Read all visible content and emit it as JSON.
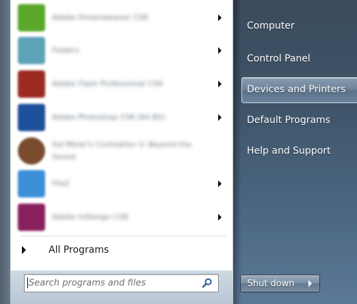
{
  "left_pane": {
    "programs": [
      {
        "label": "Adobe Dreamweaver CS6",
        "icon": "dreamweaver-icon",
        "color": "#5aa82a",
        "submenu": true
      },
      {
        "label": "Folders",
        "icon": "network-icon",
        "color": "#5fa3b8",
        "submenu": true
      },
      {
        "label": "Adobe Flash Professional CS6",
        "icon": "flash-icon",
        "color": "#9a2a22",
        "submenu": true
      },
      {
        "label": "Adobe Photoshop CS6 (64 Bit)",
        "icon": "photoshop-icon",
        "color": "#1d4f9a",
        "submenu": true
      },
      {
        "label": "Sid Meier's Civilization V: Beyond the Sound",
        "icon": "civilization-icon",
        "color": "#7a4b2c",
        "submenu": false
      },
      {
        "label": "FileZ",
        "icon": "app-icon",
        "color": "#3a8fd6",
        "submenu": true
      },
      {
        "label": "Adobe InDesign CS6",
        "icon": "indesign-icon",
        "color": "#8a1f5e",
        "submenu": true
      }
    ],
    "all_programs_label": "All Programs",
    "search_placeholder": "Search programs and files"
  },
  "right_pane": {
    "items": [
      "Computer",
      "Control Panel",
      "Devices and Printers",
      "Default Programs",
      "Help and Support"
    ],
    "highlighted_item": "Devices and Printers",
    "shutdown_label": "Shut down"
  }
}
